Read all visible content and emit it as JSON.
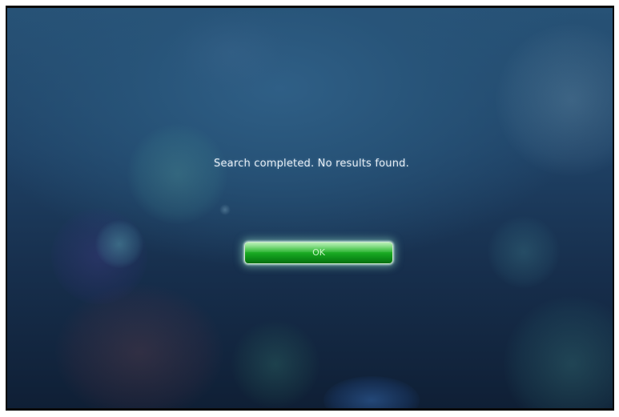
{
  "dialog": {
    "message": "Search completed. No results found.",
    "ok_label": "OK"
  },
  "colors": {
    "background_top": "#275276",
    "background_bottom": "#0f1f35",
    "button_green": "#16a520",
    "message_text": "#e6eef5"
  }
}
